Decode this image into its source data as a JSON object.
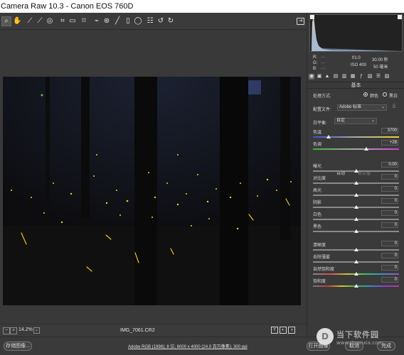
{
  "window": {
    "title": "Camera Raw 10.3 -  Canon EOS 760D"
  },
  "toolbar": {
    "tools": [
      {
        "name": "zoom-tool-icon",
        "glyph": "⌕"
      },
      {
        "name": "hand-tool-icon",
        "glyph": "✋"
      },
      {
        "name": "white-balance-tool-icon",
        "glyph": "⟋"
      },
      {
        "name": "color-sampler-tool-icon",
        "glyph": "⟋"
      },
      {
        "name": "targeted-adjustment-tool-icon",
        "glyph": "◎"
      },
      {
        "name": "crop-tool-icon",
        "glyph": "⌗"
      },
      {
        "name": "straighten-tool-icon",
        "glyph": "▭"
      },
      {
        "name": "transform-tool-icon",
        "glyph": "⌑"
      },
      {
        "name": "spot-removal-tool-icon",
        "glyph": "⌁"
      },
      {
        "name": "red-eye-removal-tool-icon",
        "glyph": "⊛"
      },
      {
        "name": "adjustment-brush-icon",
        "glyph": "╱"
      },
      {
        "name": "graduated-filter-icon",
        "glyph": "▯"
      },
      {
        "name": "radial-filter-icon",
        "glyph": "◯"
      },
      {
        "name": "preferences-icon",
        "glyph": "☷"
      },
      {
        "name": "rotate-left-icon",
        "glyph": "↺"
      },
      {
        "name": "rotate-right-icon",
        "glyph": "↻"
      }
    ],
    "export_icon": "⇥"
  },
  "status": {
    "zoom": "14.2%",
    "filename": "IMG_7061.CR2",
    "zoom_minus": "−",
    "zoom_plus": "+",
    "zoom_dropdown": "⌄",
    "view_buttons": [
      "Y",
      "◐",
      "◑"
    ]
  },
  "bottom": {
    "save_button": "存储图像...",
    "workflow_link": "Adobe RGB (1998); 8 位; 6000 x 4000 (24.0 百万像素); 300 ppi",
    "open_button": "打开图像",
    "cancel_button": "取消",
    "done_button": "完成"
  },
  "histogram": {
    "rgb_labels": [
      "R:",
      "G:",
      "B:"
    ],
    "rgb_dashes": [
      "---",
      "---",
      "---"
    ],
    "aperture": "f/1.0",
    "shutter": "30.00 秒",
    "iso": "ISO 400",
    "lens": "50 毫米"
  },
  "panel": {
    "section_title": "基本",
    "tabs": [
      {
        "name": "basic-tab-icon",
        "glyph": "◉"
      },
      {
        "name": "tone-curve-tab-icon",
        "glyph": "▣"
      },
      {
        "name": "detail-tab-icon",
        "glyph": "▲"
      },
      {
        "name": "hsl-tab-icon",
        "glyph": "▤"
      },
      {
        "name": "split-toning-tab-icon",
        "glyph": "▥"
      },
      {
        "name": "lens-tab-icon",
        "glyph": "▦"
      },
      {
        "name": "fx-tab-icon",
        "glyph": "ƒ"
      },
      {
        "name": "camera-calibration-tab-icon",
        "glyph": "▧"
      },
      {
        "name": "presets-tab-icon",
        "glyph": "☰"
      },
      {
        "name": "snapshots-tab-icon",
        "glyph": "▨"
      }
    ],
    "processing": {
      "label": "处理方式:",
      "color_option": "颜色",
      "bw_option": "黑白",
      "selected": "color"
    },
    "profile": {
      "label": "配置文件:",
      "value": "Adobe 标准"
    },
    "white_balance": {
      "label": "白平衡:",
      "value": "自定"
    },
    "auto_link": "自动",
    "default_link": "默认值",
    "sliders": [
      {
        "key": "temperature",
        "label": "色温",
        "value": "3700",
        "position": 0.18
      },
      {
        "key": "tint",
        "label": "色调",
        "value": "+28",
        "position": 0.62
      },
      {
        "key": "exposure",
        "label": "曝光",
        "value": "0.00",
        "position": 0.5
      },
      {
        "key": "contrast",
        "label": "对比度",
        "value": "0",
        "position": 0.5
      },
      {
        "key": "highlights",
        "label": "高光",
        "value": "0",
        "position": 0.5
      },
      {
        "key": "shadows",
        "label": "阴影",
        "value": "0",
        "position": 0.5
      },
      {
        "key": "whites",
        "label": "白色",
        "value": "0",
        "position": 0.5
      },
      {
        "key": "blacks",
        "label": "黑色",
        "value": "0",
        "position": 0.5
      },
      {
        "key": "clarity",
        "label": "清晰度",
        "value": "0",
        "position": 0.5
      },
      {
        "key": "dehaze",
        "label": "去除薄雾",
        "value": "0",
        "position": 0.5
      },
      {
        "key": "vibrance",
        "label": "自然饱和度",
        "value": "0",
        "position": 0.5
      },
      {
        "key": "saturation",
        "label": "饱和度",
        "value": "0",
        "position": 0.5
      }
    ]
  },
  "watermark": {
    "title": "当下软件园",
    "url": "www.downxia.com",
    "logo_glyph": "D"
  },
  "colors": {
    "panel_bg": "#3a3a3a",
    "photo_bg": "#121212",
    "firefly": "#f0d020"
  }
}
